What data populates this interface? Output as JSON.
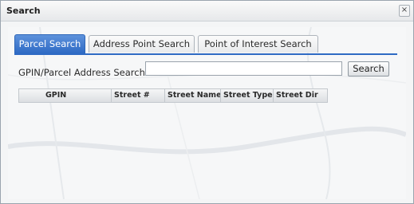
{
  "window": {
    "title": "Search",
    "close_symbol": "×"
  },
  "tabs": [
    {
      "label": "Parcel Search",
      "active": true
    },
    {
      "label": "Address Point Search",
      "active": false
    },
    {
      "label": "Point of Interest Search",
      "active": false
    }
  ],
  "parcel_search": {
    "label": "GPIN/Parcel Address Search:",
    "input_value": "",
    "button_label": "Search"
  },
  "results_grid": {
    "columns": [
      "GPIN",
      "Street #",
      "Street Name",
      "Street Type",
      "Street Dir"
    ],
    "rows": []
  },
  "colors": {
    "accent": "#2e6ac4",
    "dialog_bg": "#f4f5f6"
  }
}
